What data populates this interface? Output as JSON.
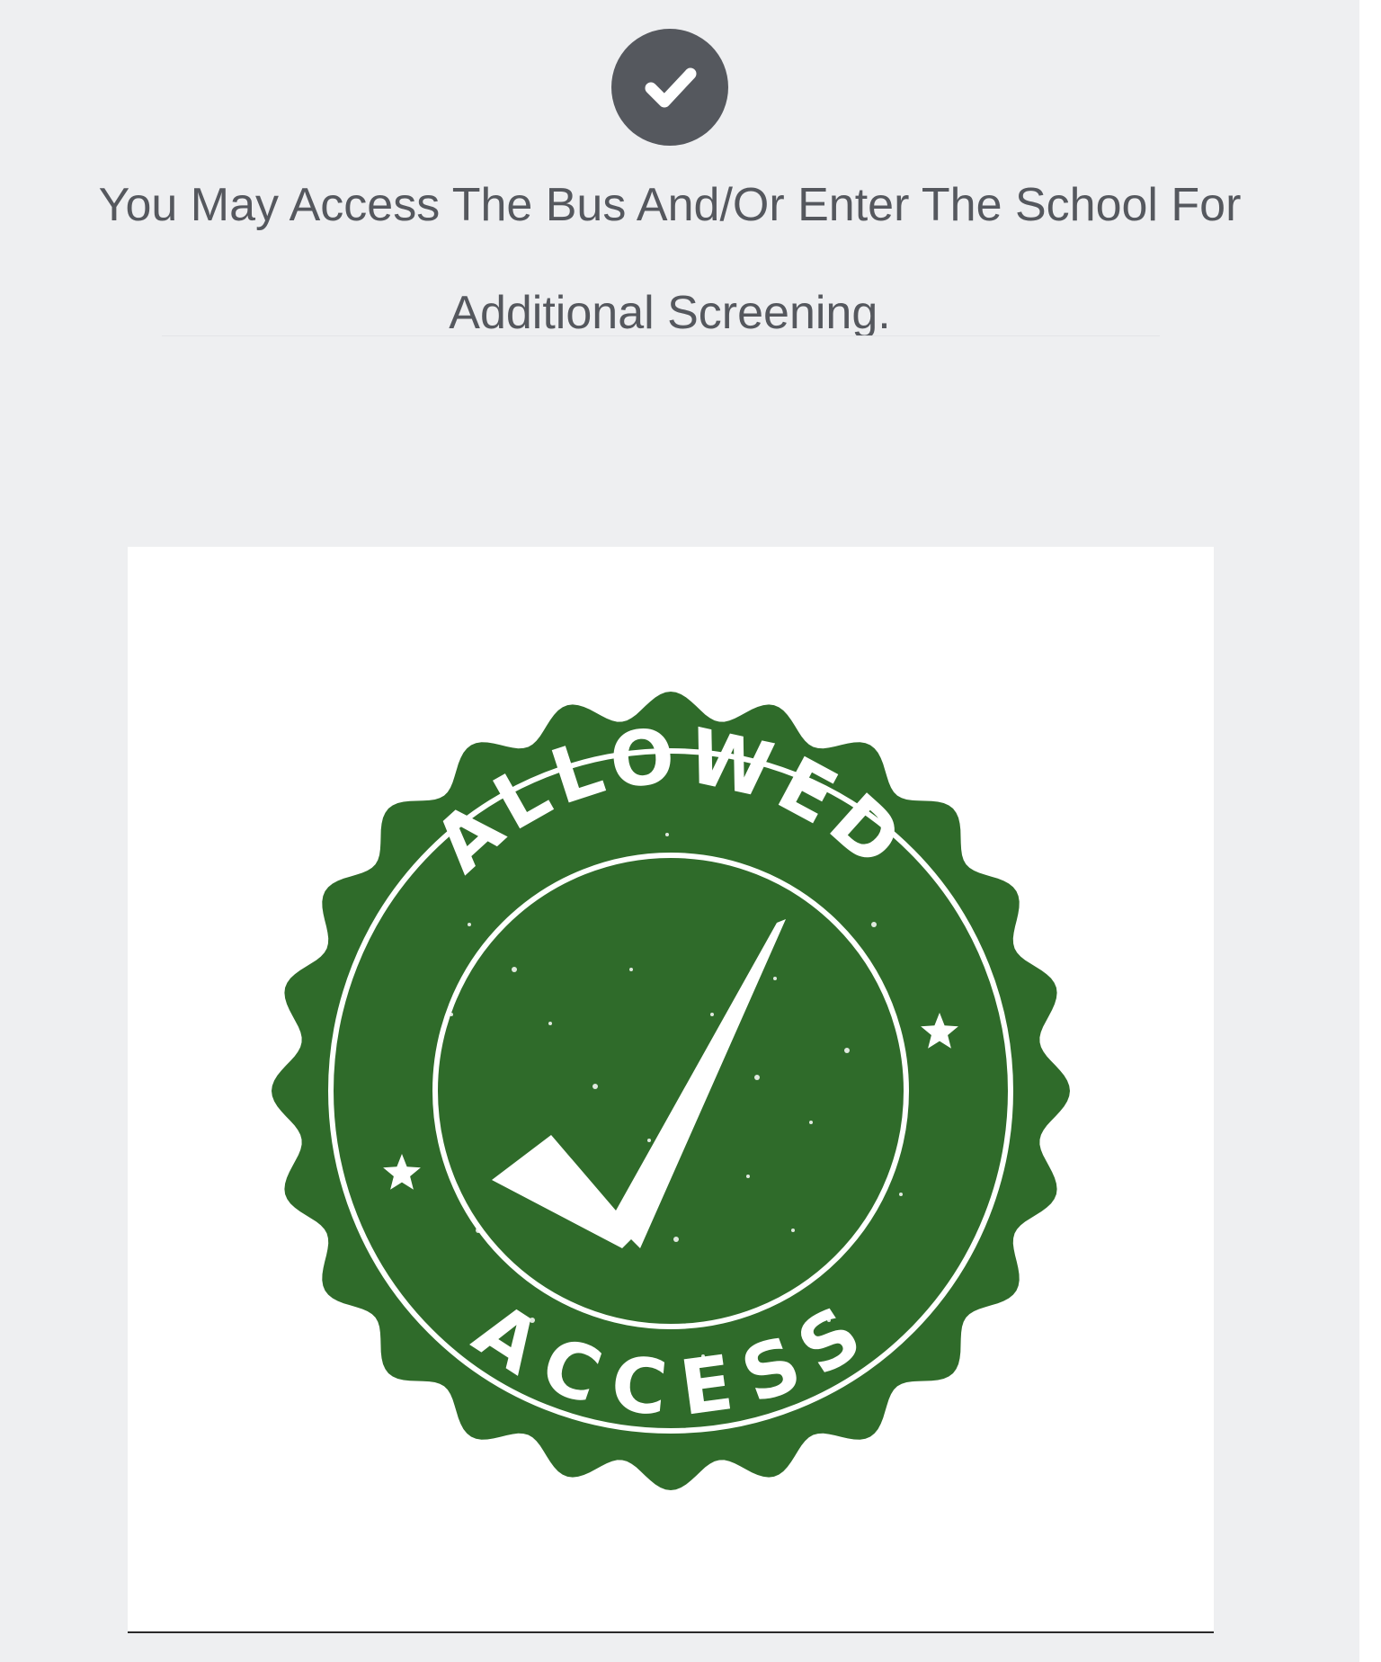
{
  "status": {
    "icon": "check-circle-icon",
    "icon_color": "#55585e",
    "message_line1": "You May Access The Bus And/Or Enter The School For",
    "message_line2": "Additional Screening."
  },
  "stamp": {
    "icon": "allowed-access-seal",
    "top_text": "ALLOWED",
    "bottom_text": "ACCESS",
    "color": "#2f6b2a"
  },
  "colors": {
    "background": "#eeeff1",
    "text": "#55585e",
    "card": "#ffffff"
  }
}
